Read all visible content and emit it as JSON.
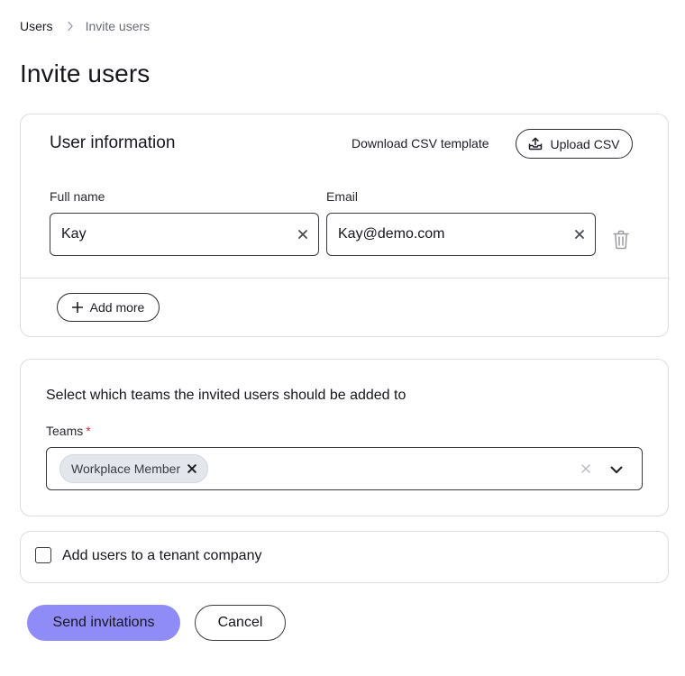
{
  "breadcrumb": {
    "items": [
      "Users",
      "Invite users"
    ],
    "separator_icon": "chevron-right-icon"
  },
  "page": {
    "title": "Invite users"
  },
  "user_info": {
    "title": "User information",
    "download_csv_label": "Download CSV template",
    "upload_csv_label": "Upload CSV",
    "upload_icon": "upload-tray-icon",
    "full_name_label": "Full name",
    "email_label": "Email",
    "rows": [
      {
        "full_name": "Kay",
        "email": "Kay@demo.com"
      }
    ],
    "clear_icon": "close-icon",
    "delete_icon": "trash-icon",
    "add_more_label": "Add more",
    "add_icon": "plus-icon"
  },
  "teams": {
    "heading": "Select which teams the invited users should be added to",
    "label": "Teams",
    "required_marker": "*",
    "selected": [
      "Workplace Member"
    ],
    "dropdown_icon": "chevron-down-icon"
  },
  "tenant": {
    "label": "Add users to a tenant company",
    "checked": false
  },
  "actions": {
    "send_label": "Send invitations",
    "cancel_label": "Cancel"
  },
  "colors": {
    "primary_button": "#8f8cf8",
    "required": "#d62839",
    "border": "#dcdde1",
    "chip_bg": "#e3e6ea"
  }
}
